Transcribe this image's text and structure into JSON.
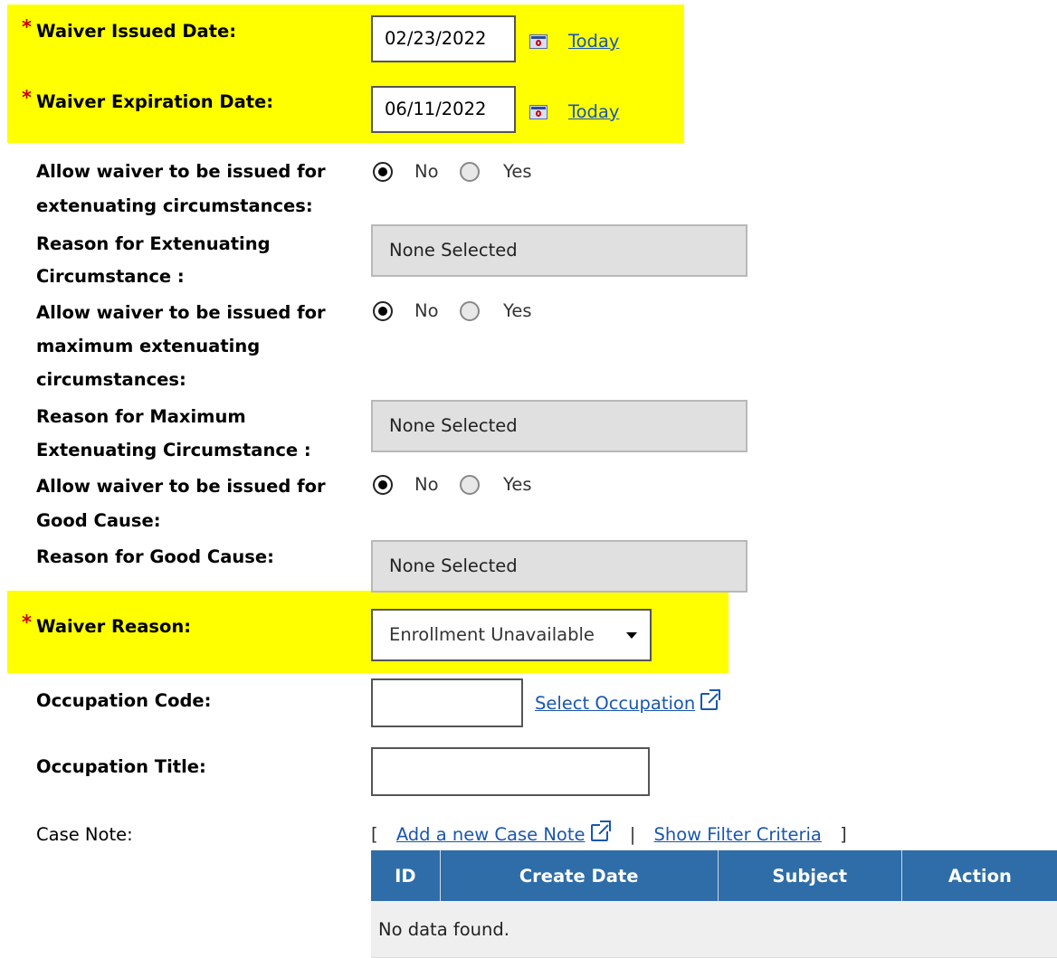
{
  "waiver_issued_date": {
    "label": "Waiver Issued Date:",
    "value": "02/23/2022",
    "today_link": "Today"
  },
  "waiver_expiration_date": {
    "label": "Waiver Expiration Date:",
    "value": "06/11/2022",
    "today_link": "Today"
  },
  "extenuating": {
    "label_line1": "Allow waiver to be issued for",
    "label_line2": "extenuating circumstances:",
    "options": [
      "No",
      "Yes"
    ],
    "selected": "No"
  },
  "extenuating_reason": {
    "label_line1": "Reason for Extenuating",
    "label_line2": "Circumstance :",
    "value": "None Selected"
  },
  "max_extenuating": {
    "label_line1": "Allow waiver to be issued for",
    "label_line2": "maximum extenuating",
    "label_line3": "circumstances:",
    "options": [
      "No",
      "Yes"
    ],
    "selected": "No"
  },
  "max_extenuating_reason": {
    "label_line1": "Reason for Maximum",
    "label_line2": "Extenuating Circumstance :",
    "value": "None Selected"
  },
  "good_cause": {
    "label_line1": "Allow waiver to be issued for",
    "label_line2": "Good Cause:",
    "options": [
      "No",
      "Yes"
    ],
    "selected": "No"
  },
  "good_cause_reason": {
    "label": "Reason for Good Cause:",
    "value": "None Selected"
  },
  "waiver_reason": {
    "label": "Waiver Reason:",
    "value": "Enrollment Unavailable"
  },
  "occupation_code": {
    "label": "Occupation Code:",
    "value": "",
    "select_link": "Select Occupation"
  },
  "occupation_title": {
    "label": "Occupation Title:",
    "value": ""
  },
  "case_note": {
    "label": "Case Note:",
    "open_bracket": "[",
    "add_link": "Add a new Case Note",
    "separator": "|",
    "filter_link": "Show Filter Criteria",
    "close_bracket": "]",
    "columns": [
      "ID",
      "Create Date",
      "Subject",
      "Action"
    ],
    "empty_message": "No data found."
  },
  "colors": {
    "highlight": "#ffff00",
    "required_star": "#cc0000",
    "link": "#1a56b0",
    "table_header": "#2e6da8"
  }
}
